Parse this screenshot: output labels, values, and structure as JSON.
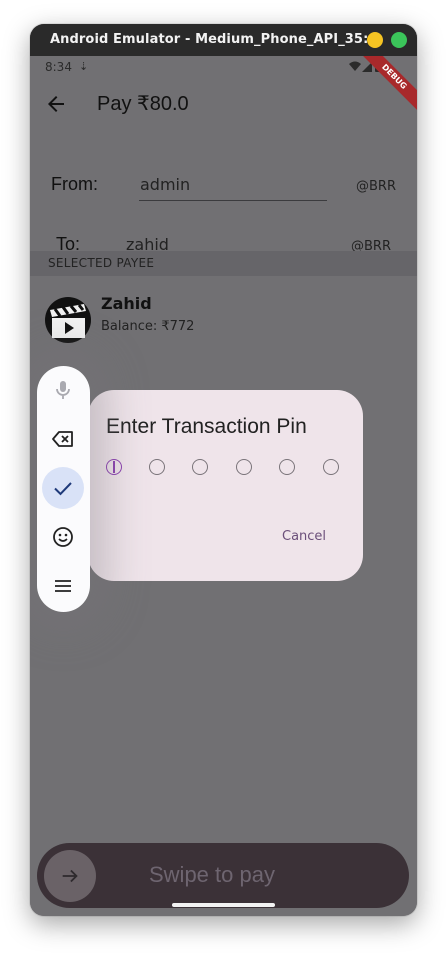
{
  "window": {
    "title": "Android Emulator - Medium_Phone_API_35:..."
  },
  "status_bar": {
    "time": "8:34",
    "debug_label": "DEBUG"
  },
  "app_bar": {
    "title": "Pay ₹80.0"
  },
  "form": {
    "from_label": "From:",
    "from_value": "admin",
    "from_suffix": "@BRR",
    "to_label": "To:",
    "to_value": "zahid",
    "to_suffix": "@BRR"
  },
  "selected_payee": {
    "header": "SELECTED PAYEE",
    "name": "Zahid",
    "balance": "Balance: ₹772"
  },
  "pin_dialog": {
    "title": "Enter Transaction Pin",
    "pin_length": 6,
    "cancel_label": "Cancel"
  },
  "keyboard_toolbar": {
    "icons": [
      "mic-icon",
      "backspace-icon",
      "check-icon",
      "emoji-icon",
      "menu-icon"
    ],
    "selected": "check-icon"
  },
  "swipe": {
    "label": "Swipe to pay"
  },
  "colors": {
    "overlay_background": "#717073",
    "dialog_background": "#efe4ea",
    "pin_active": "#8a3fb0",
    "swipe_background": "#3b3137",
    "debug_ribbon": "#a8292b"
  }
}
